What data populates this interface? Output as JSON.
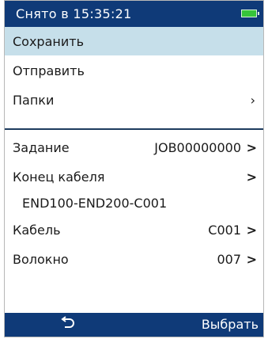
{
  "status": {
    "title": "Снято в 15:35:21",
    "battery_icon": "battery-icon"
  },
  "menu": {
    "items": [
      {
        "label": "Сохранить",
        "chevron": ""
      },
      {
        "label": "Отправить",
        "chevron": ""
      },
      {
        "label": "Папки",
        "chevron": "›"
      }
    ]
  },
  "props": {
    "job": {
      "label": "Задание",
      "value": "JOB00000000",
      "arrow": ">"
    },
    "cable_end": {
      "label": "Конец кабеля",
      "arrow": ">",
      "value": "END100-END200-C001"
    },
    "cable": {
      "label": "Кабель",
      "value": "C001",
      "arrow": ">"
    },
    "fiber": {
      "label": "Волокно",
      "value": "007",
      "arrow": ">"
    }
  },
  "bottom": {
    "back_icon": "back-icon",
    "select_label": "Выбрать"
  },
  "colors": {
    "bar": "#0f3a78",
    "selected": "#c6dfea",
    "battery": "#36c43a"
  }
}
